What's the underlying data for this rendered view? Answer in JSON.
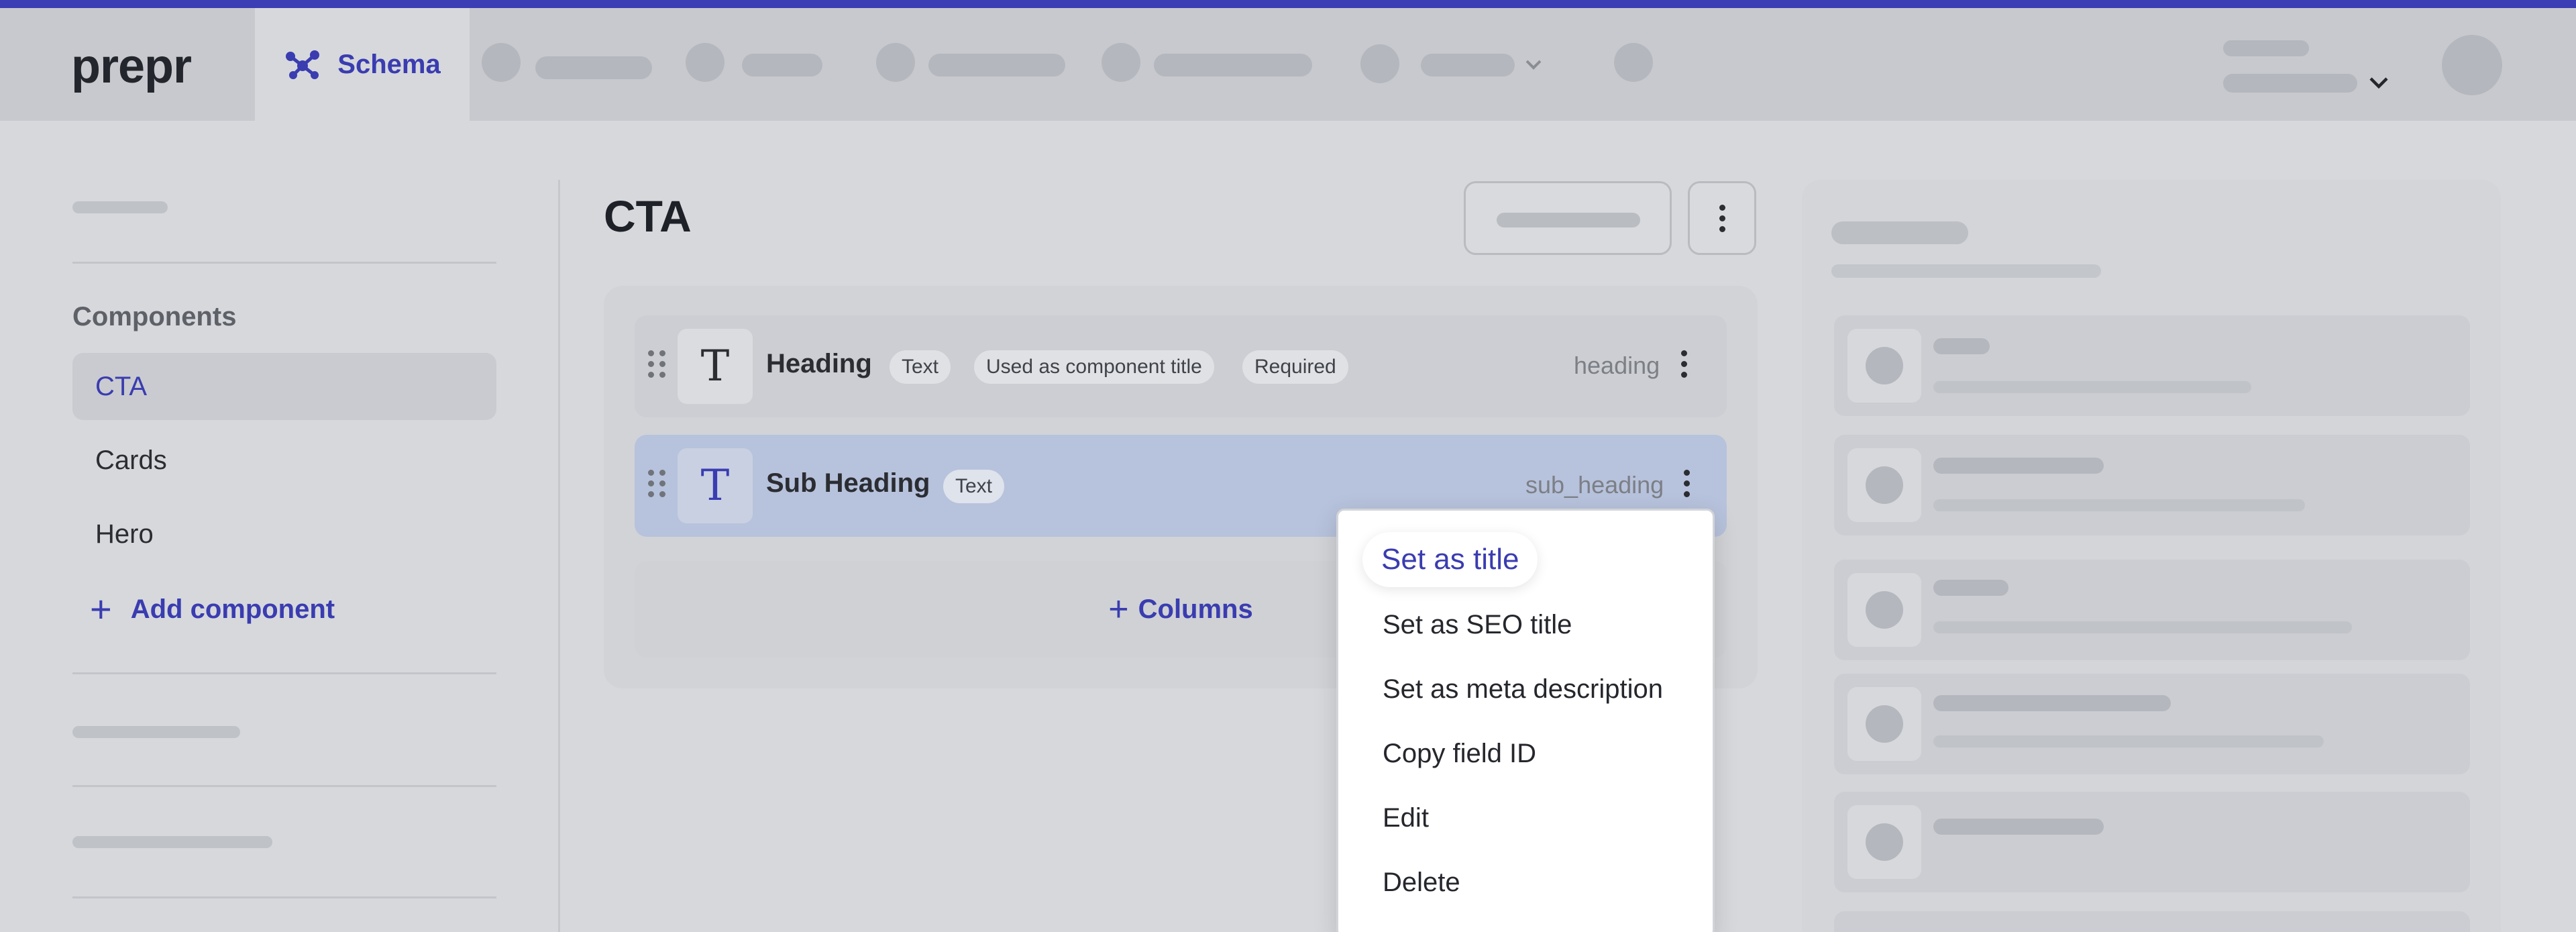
{
  "header": {
    "logo": "prepr",
    "active_tab": {
      "label": "Schema",
      "icon": "schema-network-icon"
    }
  },
  "sidebar": {
    "components_heading": "Components",
    "items": [
      {
        "label": "CTA",
        "active": true
      },
      {
        "label": "Cards",
        "active": false
      },
      {
        "label": "Hero",
        "active": false
      }
    ],
    "add_label": "Add component"
  },
  "main": {
    "title": "CTA",
    "fields": [
      {
        "name": "Heading",
        "type_badge": "Text",
        "badges": [
          "Used as component title",
          "Required"
        ],
        "api_id": "heading",
        "icon": "text-type-icon"
      },
      {
        "name": "Sub Heading",
        "type_badge": "Text",
        "badges": [],
        "api_id": "sub_heading",
        "icon": "text-type-icon",
        "selected": true
      }
    ],
    "columns_label": "Columns"
  },
  "context_menu": {
    "items": [
      "Set as title",
      "Set as SEO title",
      "Set as meta description",
      "Copy field ID",
      "Edit",
      "Delete"
    ],
    "highlighted": "Set as title"
  },
  "colors": {
    "accent": "#3a3cb0",
    "top_bar": "#3b3eb4",
    "selected_row": "#b7c2dc",
    "background": "#d6d8dc"
  }
}
